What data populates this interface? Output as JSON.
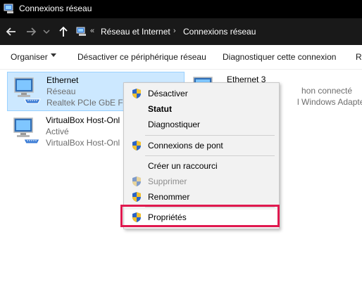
{
  "window": {
    "title": "Connexions réseau"
  },
  "address_bar": {
    "breadcrumbs": [
      "Réseau et Internet",
      "Connexions réseau"
    ],
    "overflow": "«"
  },
  "toolbar": {
    "organize_label": "Organiser",
    "disable_label": "Désactiver ce périphérique réseau",
    "diagnose_label": "Diagnostiquer cette connexion",
    "overflow_label": "R"
  },
  "connections": [
    {
      "name": "Ethernet",
      "status": "Réseau",
      "adapter": "Realtek PCIe GbE Far"
    },
    {
      "name": "VirtualBox Host-Onl",
      "status": "Activé",
      "adapter": "VirtualBox Host-Onl"
    },
    {
      "name": "Ethernet 3",
      "status": "hon connecté",
      "adapter": "l Windows Adapter ..."
    }
  ],
  "context_menu": {
    "items": [
      {
        "label": "Désactiver",
        "shield": true
      },
      {
        "label": "Statut",
        "bold": true
      },
      {
        "label": "Diagnostiquer"
      },
      {
        "label": "Connexions de pont",
        "shield": true
      },
      {
        "label": "Créer un raccourci"
      },
      {
        "label": "Supprimer",
        "shield": true,
        "disabled": true
      },
      {
        "label": "Renommer",
        "shield": true
      },
      {
        "label": "Propriétés",
        "shield": true,
        "highlighted": true
      }
    ]
  },
  "colors": {
    "titlebar": "#000000",
    "navbar": "#191919",
    "selection": "#cce8ff",
    "highlight_border": "#e0194f"
  },
  "icons": [
    "network-app-icon",
    "back-arrow-icon",
    "forward-arrow-icon",
    "recent-dropdown-icon",
    "up-arrow-icon",
    "network-connection-icon",
    "uac-shield-icon"
  ]
}
